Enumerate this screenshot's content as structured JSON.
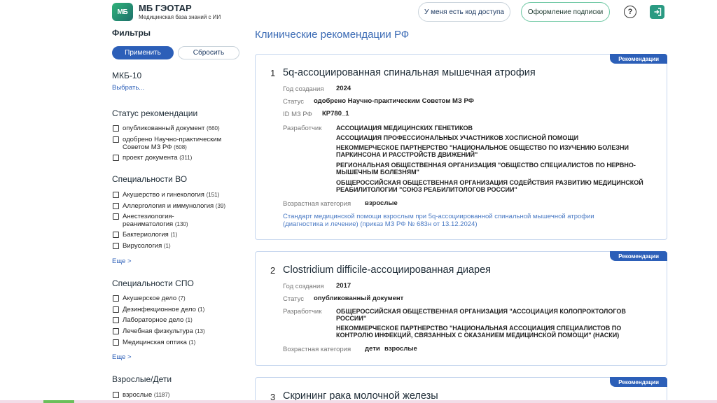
{
  "header": {
    "logo_text": "МБ",
    "title": "МБ ГЭОТАР",
    "subtitle": "Медицинская база знаний с ИИ",
    "access_code_label": "У меня есть код доступа",
    "subscribe_label": "Оформление подписки",
    "help_glyph": "?"
  },
  "sidebar": {
    "title": "Фильтры",
    "apply_label": "Применить",
    "reset_label": "Сбросить",
    "mkb": {
      "title": "МКБ-10",
      "select_label": "Выбрать..."
    },
    "status": {
      "title": "Статус рекомендации",
      "items": [
        {
          "label": "опубликованный документ",
          "count": "(660)"
        },
        {
          "label": "одобрено Научно-практическим Советом МЗ РФ",
          "count": "(608)"
        },
        {
          "label": "проект документа",
          "count": "(311)"
        }
      ]
    },
    "vo": {
      "title": "Специальности ВО",
      "items": [
        {
          "label": "Акушерство и гинекология",
          "count": "(151)"
        },
        {
          "label": "Аллергология и иммунология",
          "count": "(39)"
        },
        {
          "label": "Анестезиология-реаниматология",
          "count": "(130)"
        },
        {
          "label": "Бактериология",
          "count": "(1)"
        },
        {
          "label": "Вирусология",
          "count": "(1)"
        }
      ],
      "more_label": "Еще >"
    },
    "spo": {
      "title": "Специальности СПО",
      "items": [
        {
          "label": "Акушерское дело",
          "count": "(7)"
        },
        {
          "label": "Дезинфекционное дело",
          "count": "(1)"
        },
        {
          "label": "Лабораторное дело",
          "count": "(1)"
        },
        {
          "label": "Лечебная физкультура",
          "count": "(13)"
        },
        {
          "label": "Медицинская оптика",
          "count": "(1)"
        }
      ],
      "more_label": "Еще >"
    },
    "age": {
      "title": "Взрослые/Дети",
      "items": [
        {
          "label": "взрослые",
          "count": "(1187)"
        }
      ]
    }
  },
  "main": {
    "title": "Клинические рекомендации РФ",
    "badge_label": "Рекомендации",
    "labels": {
      "year": "Год создания",
      "status": "Статус",
      "id": "ID МЗ РФ",
      "developer": "Разработчик",
      "age": "Возрастная категория"
    },
    "cards": [
      {
        "num": "1",
        "title": "5q-ассоциированная спинальная мышечная атрофия",
        "year": "2024",
        "status": "одобрено Научно-практическим Советом МЗ РФ",
        "id": "КР780_1",
        "developers": [
          "АССОЦИАЦИЯ МЕДИЦИНСКИХ ГЕНЕТИКОВ",
          "АССОЦИАЦИЯ ПРОФЕССИОНАЛЬНЫХ УЧАСТНИКОВ ХОСПИСНОЙ ПОМОЩИ",
          "НЕКОММЕРЧЕСКОЕ ПАРТНЕРСТВО \"НАЦИОНАЛЬНОЕ ОБЩЕСТВО ПО ИЗУЧЕНИЮ БОЛЕЗНИ ПАРКИНСОНА И РАССТРОЙСТВ ДВИЖЕНИЙ\"",
          "РЕГИОНАЛЬНАЯ ОБЩЕСТВЕННАЯ ОРГАНИЗАЦИЯ \"ОБЩЕСТВО СПЕЦИАЛИСТОВ ПО НЕРВНО-МЫШЕЧНЫМ БОЛЕЗНЯМ\"",
          "ОБЩЕРОССИЙСКАЯ ОБЩЕСТВЕННАЯ ОРГАНИЗАЦИЯ СОДЕЙСТВИЯ РАЗВИТИЮ МЕДИЦИНСКОЙ РЕАБИЛИТОЛОГИИ \"СОЮЗ РЕАБИЛИТОЛОГОВ РОССИИ\""
        ],
        "age": "взрослые",
        "standard_link": "Стандарт медицинской помощи взрослым при 5q-ассоциированной спинальной мышечной атрофии (диагностика и лечение) (приказ МЗ РФ № 683н от 13.12.2024)"
      },
      {
        "num": "2",
        "title": "Clostridium difficile-ассоциированная диарея",
        "year": "2017",
        "status": "опубликованный документ",
        "developers": [
          "ОБЩЕРОССИЙСКАЯ ОБЩЕСТВЕННАЯ ОРГАНИЗАЦИЯ \"АССОЦИАЦИЯ КОЛОПРОКТОЛОГОВ РОССИИ\"",
          "НЕКОММЕРЧЕСКОЕ ПАРТНЕРСТВО \"НАЦИОНАЛЬНАЯ АССОЦИАЦИЯ СПЕЦИАЛИСТОВ ПО КОНТРОЛЮ ИНФЕКЦИЙ, СВЯЗАННЫХ С ОКАЗАНИЕМ МЕДИЦИНСКОЙ ПОМОЩИ\" (НАСКИ)"
        ],
        "age_child": "дети",
        "age_adult": "взрослые"
      },
      {
        "num": "3",
        "title": "Скрининг рака молочной железы"
      }
    ]
  }
}
